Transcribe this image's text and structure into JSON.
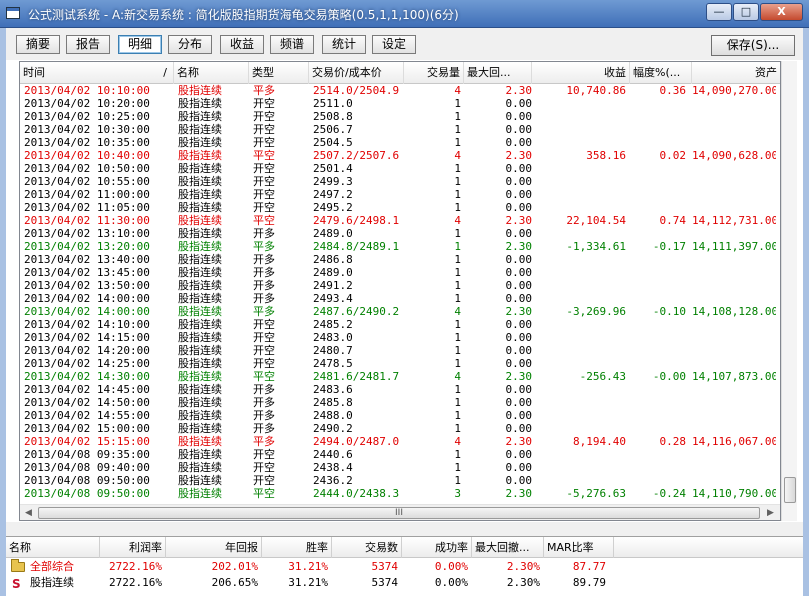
{
  "window": {
    "title": "公式测试系统 - A:新交易系统 : 简化版股指期货海龟交易策略(0.5,1,1,100)(6分)",
    "btn_min": "—",
    "btn_max": "□",
    "btn_close": "X"
  },
  "toolbar": {
    "tabs": [
      "摘要",
      "报告",
      "明细",
      "分布",
      "收益",
      "频谱",
      "统计",
      "设定"
    ],
    "active_tab": "明细",
    "save_label": "保存(S)..."
  },
  "grid": {
    "columns": [
      "时间",
      "名称",
      "类型",
      "交易价/成本价",
      "交易量",
      "最大回...",
      "收益",
      "幅度%(...",
      "资产"
    ],
    "sort_indicator": "/",
    "rows": [
      {
        "c": "red",
        "t": "2013/04/02  10:10:00",
        "n": "股指连续",
        "ty": "平多",
        "p": "2514.0/2504.9",
        "q": "4",
        "d": "2.30",
        "pr": "10,740.86",
        "pc": "0.36",
        "a": "14,090,270.00"
      },
      {
        "c": "black",
        "t": "2013/04/02  10:20:00",
        "n": "股指连续",
        "ty": "开空",
        "p": "2511.0",
        "q": "1",
        "d": "0.00",
        "pr": "",
        "pc": "",
        "a": ""
      },
      {
        "c": "black",
        "t": "2013/04/02  10:25:00",
        "n": "股指连续",
        "ty": "开空",
        "p": "2508.8",
        "q": "1",
        "d": "0.00",
        "pr": "",
        "pc": "",
        "a": ""
      },
      {
        "c": "black",
        "t": "2013/04/02  10:30:00",
        "n": "股指连续",
        "ty": "开空",
        "p": "2506.7",
        "q": "1",
        "d": "0.00",
        "pr": "",
        "pc": "",
        "a": ""
      },
      {
        "c": "black",
        "t": "2013/04/02  10:35:00",
        "n": "股指连续",
        "ty": "开空",
        "p": "2504.5",
        "q": "1",
        "d": "0.00",
        "pr": "",
        "pc": "",
        "a": ""
      },
      {
        "c": "red",
        "t": "2013/04/02  10:40:00",
        "n": "股指连续",
        "ty": "平空",
        "p": "2507.2/2507.6",
        "q": "4",
        "d": "2.30",
        "pr": "358.16",
        "pc": "0.02",
        "a": "14,090,628.00"
      },
      {
        "c": "black",
        "t": "2013/04/02  10:50:00",
        "n": "股指连续",
        "ty": "开空",
        "p": "2501.4",
        "q": "1",
        "d": "0.00",
        "pr": "",
        "pc": "",
        "a": ""
      },
      {
        "c": "black",
        "t": "2013/04/02  10:55:00",
        "n": "股指连续",
        "ty": "开空",
        "p": "2499.3",
        "q": "1",
        "d": "0.00",
        "pr": "",
        "pc": "",
        "a": ""
      },
      {
        "c": "black",
        "t": "2013/04/02  11:00:00",
        "n": "股指连续",
        "ty": "开空",
        "p": "2497.2",
        "q": "1",
        "d": "0.00",
        "pr": "",
        "pc": "",
        "a": ""
      },
      {
        "c": "black",
        "t": "2013/04/02  11:05:00",
        "n": "股指连续",
        "ty": "开空",
        "p": "2495.2",
        "q": "1",
        "d": "0.00",
        "pr": "",
        "pc": "",
        "a": ""
      },
      {
        "c": "red",
        "t": "2013/04/02  11:30:00",
        "n": "股指连续",
        "ty": "平空",
        "p": "2479.6/2498.1",
        "q": "4",
        "d": "2.30",
        "pr": "22,104.54",
        "pc": "0.74",
        "a": "14,112,731.00"
      },
      {
        "c": "black",
        "t": "2013/04/02  13:10:00",
        "n": "股指连续",
        "ty": "开多",
        "p": "2489.0",
        "q": "1",
        "d": "0.00",
        "pr": "",
        "pc": "",
        "a": ""
      },
      {
        "c": "green",
        "t": "2013/04/02  13:20:00",
        "n": "股指连续",
        "ty": "平多",
        "p": "2484.8/2489.1",
        "q": "1",
        "d": "2.30",
        "pr": "-1,334.61",
        "pc": "-0.17",
        "a": "14,111,397.00"
      },
      {
        "c": "black",
        "t": "2013/04/02  13:40:00",
        "n": "股指连续",
        "ty": "开多",
        "p": "2486.8",
        "q": "1",
        "d": "0.00",
        "pr": "",
        "pc": "",
        "a": ""
      },
      {
        "c": "black",
        "t": "2013/04/02  13:45:00",
        "n": "股指连续",
        "ty": "开多",
        "p": "2489.0",
        "q": "1",
        "d": "0.00",
        "pr": "",
        "pc": "",
        "a": ""
      },
      {
        "c": "black",
        "t": "2013/04/02  13:50:00",
        "n": "股指连续",
        "ty": "开多",
        "p": "2491.2",
        "q": "1",
        "d": "0.00",
        "pr": "",
        "pc": "",
        "a": ""
      },
      {
        "c": "black",
        "t": "2013/04/02  14:00:00",
        "n": "股指连续",
        "ty": "开多",
        "p": "2493.4",
        "q": "1",
        "d": "0.00",
        "pr": "",
        "pc": "",
        "a": ""
      },
      {
        "c": "green",
        "t": "2013/04/02  14:00:00",
        "n": "股指连续",
        "ty": "平多",
        "p": "2487.6/2490.2",
        "q": "4",
        "d": "2.30",
        "pr": "-3,269.96",
        "pc": "-0.10",
        "a": "14,108,128.00"
      },
      {
        "c": "black",
        "t": "2013/04/02  14:10:00",
        "n": "股指连续",
        "ty": "开空",
        "p": "2485.2",
        "q": "1",
        "d": "0.00",
        "pr": "",
        "pc": "",
        "a": ""
      },
      {
        "c": "black",
        "t": "2013/04/02  14:15:00",
        "n": "股指连续",
        "ty": "开空",
        "p": "2483.0",
        "q": "1",
        "d": "0.00",
        "pr": "",
        "pc": "",
        "a": ""
      },
      {
        "c": "black",
        "t": "2013/04/02  14:20:00",
        "n": "股指连续",
        "ty": "开空",
        "p": "2480.7",
        "q": "1",
        "d": "0.00",
        "pr": "",
        "pc": "",
        "a": ""
      },
      {
        "c": "black",
        "t": "2013/04/02  14:25:00",
        "n": "股指连续",
        "ty": "开空",
        "p": "2478.5",
        "q": "1",
        "d": "0.00",
        "pr": "",
        "pc": "",
        "a": ""
      },
      {
        "c": "green",
        "t": "2013/04/02  14:30:00",
        "n": "股指连续",
        "ty": "平空",
        "p": "2481.6/2481.7",
        "q": "4",
        "d": "2.30",
        "pr": "-256.43",
        "pc": "-0.00",
        "a": "14,107,873.00"
      },
      {
        "c": "black",
        "t": "2013/04/02  14:45:00",
        "n": "股指连续",
        "ty": "开多",
        "p": "2483.6",
        "q": "1",
        "d": "0.00",
        "pr": "",
        "pc": "",
        "a": ""
      },
      {
        "c": "black",
        "t": "2013/04/02  14:50:00",
        "n": "股指连续",
        "ty": "开多",
        "p": "2485.8",
        "q": "1",
        "d": "0.00",
        "pr": "",
        "pc": "",
        "a": ""
      },
      {
        "c": "black",
        "t": "2013/04/02  14:55:00",
        "n": "股指连续",
        "ty": "开多",
        "p": "2488.0",
        "q": "1",
        "d": "0.00",
        "pr": "",
        "pc": "",
        "a": ""
      },
      {
        "c": "black",
        "t": "2013/04/02  15:00:00",
        "n": "股指连续",
        "ty": "开多",
        "p": "2490.2",
        "q": "1",
        "d": "0.00",
        "pr": "",
        "pc": "",
        "a": ""
      },
      {
        "c": "red",
        "t": "2013/04/02  15:15:00",
        "n": "股指连续",
        "ty": "平多",
        "p": "2494.0/2487.0",
        "q": "4",
        "d": "2.30",
        "pr": "8,194.40",
        "pc": "0.28",
        "a": "14,116,067.00"
      },
      {
        "c": "black",
        "t": "2013/04/08  09:35:00",
        "n": "股指连续",
        "ty": "开空",
        "p": "2440.6",
        "q": "1",
        "d": "0.00",
        "pr": "",
        "pc": "",
        "a": ""
      },
      {
        "c": "black",
        "t": "2013/04/08  09:40:00",
        "n": "股指连续",
        "ty": "开空",
        "p": "2438.4",
        "q": "1",
        "d": "0.00",
        "pr": "",
        "pc": "",
        "a": ""
      },
      {
        "c": "black",
        "t": "2013/04/08  09:50:00",
        "n": "股指连续",
        "ty": "开空",
        "p": "2436.2",
        "q": "1",
        "d": "0.00",
        "pr": "",
        "pc": "",
        "a": ""
      },
      {
        "c": "green",
        "t": "2013/04/08  09:50:00",
        "n": "股指连续",
        "ty": "平空",
        "p": "2444.0/2438.3",
        "q": "3",
        "d": "2.30",
        "pr": "-5,276.63",
        "pc": "-0.24",
        "a": "14,110,790.00"
      }
    ]
  },
  "hscroll": {
    "left_arrow": "◀",
    "right_arrow": "▶",
    "grip": "III"
  },
  "summary": {
    "columns": [
      "名称",
      "利润率",
      "年回报",
      "胜率",
      "交易数",
      "成功率",
      "最大回撤...",
      "MAR比率"
    ],
    "rows": [
      {
        "c": "red",
        "icon": "folder",
        "n": "全部综合",
        "v": [
          "2722.16%",
          "202.01%",
          "31.21%",
          "5374",
          "0.00%",
          "2.30%",
          "87.77"
        ]
      },
      {
        "c": "black",
        "icon": "S",
        "n": "股指连续",
        "v": [
          "2722.16%",
          "206.65%",
          "31.21%",
          "5374",
          "0.00%",
          "2.30%",
          "89.79"
        ]
      }
    ]
  }
}
